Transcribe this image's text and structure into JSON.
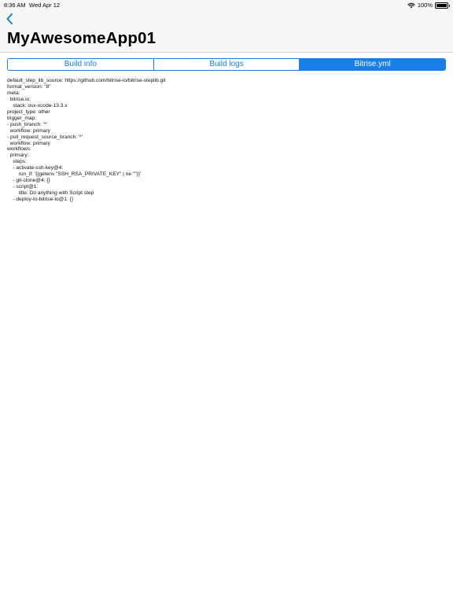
{
  "status_bar": {
    "time": "8:36 AM",
    "date": "Wed Apr 12",
    "battery": "100%",
    "battery_level": 1.0
  },
  "nav": {
    "title": "MyAwesomeApp01",
    "back_icon": "chevron-left-icon"
  },
  "tabs": [
    {
      "label": "Build info",
      "selected": false
    },
    {
      "label": "Build logs",
      "selected": false
    },
    {
      "label": "Bitrise.yml",
      "selected": true
    }
  ],
  "content": {
    "yaml": "default_step_lib_source: https://github.com/bitrise-io/bitrise-steplib.git\nformat_version: \"8\"\nmeta:\n  bitrise.io:\n    stack: osx-xcode-13.3.x\nproject_type: other\ntrigger_map:\n- push_branch: '*'\n  workflow: primary\n- pull_request_source_branch: '*'\n  workflow: primary\nworkflows:\n  primary:\n    steps:\n    - activate-ssh-key@4:\n        run_if: '{{getenv \"SSH_RSA_PRIVATE_KEY\" | ne \"\"}}'\n    - git-clone@4: {}\n    - script@1:\n        title: Do anything with Script step\n    - deploy-to-bitrise-io@1: {}"
  },
  "colors": {
    "accent": "#1a7ee8",
    "header_background": "#f7f7f7"
  }
}
